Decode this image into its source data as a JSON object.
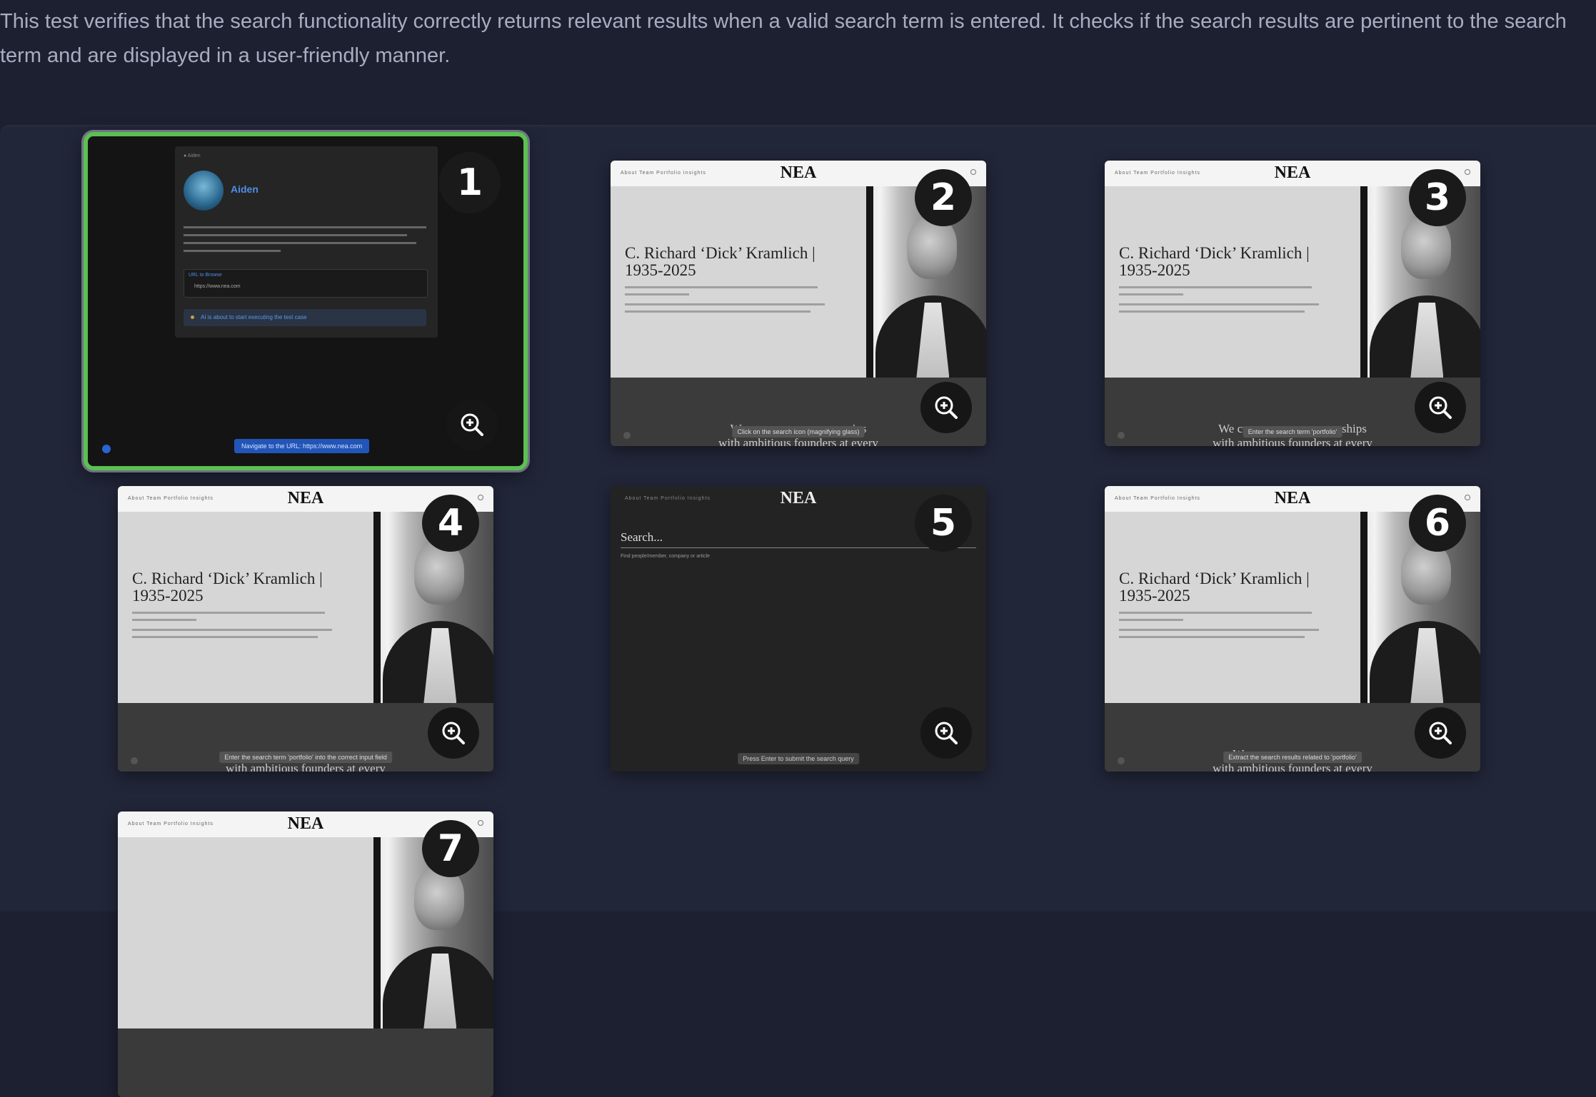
{
  "description": "This test verifies that the search functionality correctly returns relevant results when a valid search term is entered. It checks if the search results are pertinent to the search term and are displayed in a user-friendly manner.",
  "colors": {
    "background": "#1d2031",
    "panel": "#222639",
    "selected_border": "#5cc052",
    "accent_blue": "#4d8ee8"
  },
  "icons": {
    "zoom": "zoom-in-icon"
  },
  "site": {
    "logo": "NEA",
    "headline": "C. Richard ‘Dick’ Kramlich |\n1935-2025",
    "tagline_fragment": "with ambitious founders at every"
  },
  "steps": [
    {
      "number": "1",
      "kind": "agent",
      "agent_name": "Aiden",
      "status": "AI is about to start executing the test case",
      "url_value": "https://www.nea.com",
      "action": "Navigate to the URL: https://www.nea.com"
    },
    {
      "number": "2",
      "kind": "site",
      "tip": "Click on the search icon (magnifying glass)",
      "serif_left": "We",
      "serif_right": "ips"
    },
    {
      "number": "3",
      "kind": "site",
      "tip": "Enter the search term 'portfolio'",
      "serif_left": "We cr",
      "serif_right": "rships"
    },
    {
      "number": "4",
      "kind": "site",
      "tip": "Enter the search term 'portfolio' into the correct input field",
      "serif_left": "",
      "serif_right": ""
    },
    {
      "number": "5",
      "kind": "search",
      "placeholder": "Search...",
      "hint": "Find people/member, company or article",
      "tip": "Press Enter to submit the search query"
    },
    {
      "number": "6",
      "kind": "site",
      "tip": "Extract the search results related to 'portfolio'",
      "serif_left": "W",
      "serif_right": "ps"
    },
    {
      "number": "7",
      "kind": "site",
      "tip": "",
      "serif_left": "",
      "serif_right": ""
    }
  ]
}
